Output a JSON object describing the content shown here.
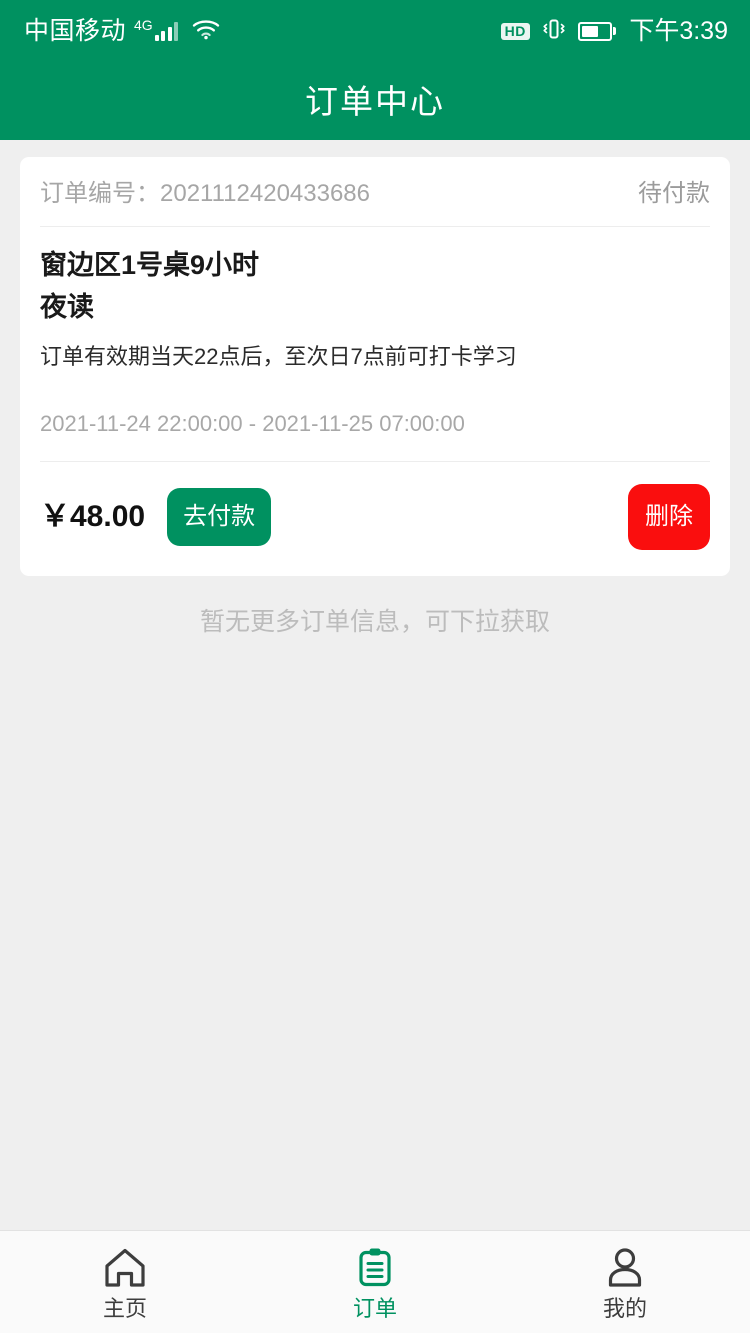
{
  "statusbar": {
    "carrier": "中国移动",
    "network": "4G",
    "hd_label": "HD",
    "time": "下午3:39",
    "battery_percent": 62,
    "icons": {
      "signal": "signal-bars-icon",
      "wifi": "wifi-icon",
      "vibrate": "vibrate-icon",
      "battery": "battery-icon"
    }
  },
  "header": {
    "title": "订单中心",
    "background_color": "#009160"
  },
  "order": {
    "order_no_label": "订单编号：",
    "order_no": "2021112420433686",
    "status": "待付款",
    "seat": "窗边区1号桌9小时",
    "plan": "夜读",
    "description": "订单有效期当天22点后，至次日7点前可打卡学习",
    "period": "2021-11-24 22:00:00 - 2021-11-25 07:00:00",
    "price": "￥48.00",
    "pay_button": "去付款",
    "delete_button": "删除",
    "pay_button_color": "#009160",
    "delete_button_color": "#fa0e0e"
  },
  "list": {
    "no_more_text": "暂无更多订单信息，可下拉获取"
  },
  "tabbar": {
    "active_color": "#009160",
    "inactive_color": "#3d3d3d",
    "items": [
      {
        "label": "主页",
        "icon": "home-icon"
      },
      {
        "label": "订单",
        "icon": "clipboard-icon"
      },
      {
        "label": "我的",
        "icon": "person-icon"
      }
    ]
  }
}
